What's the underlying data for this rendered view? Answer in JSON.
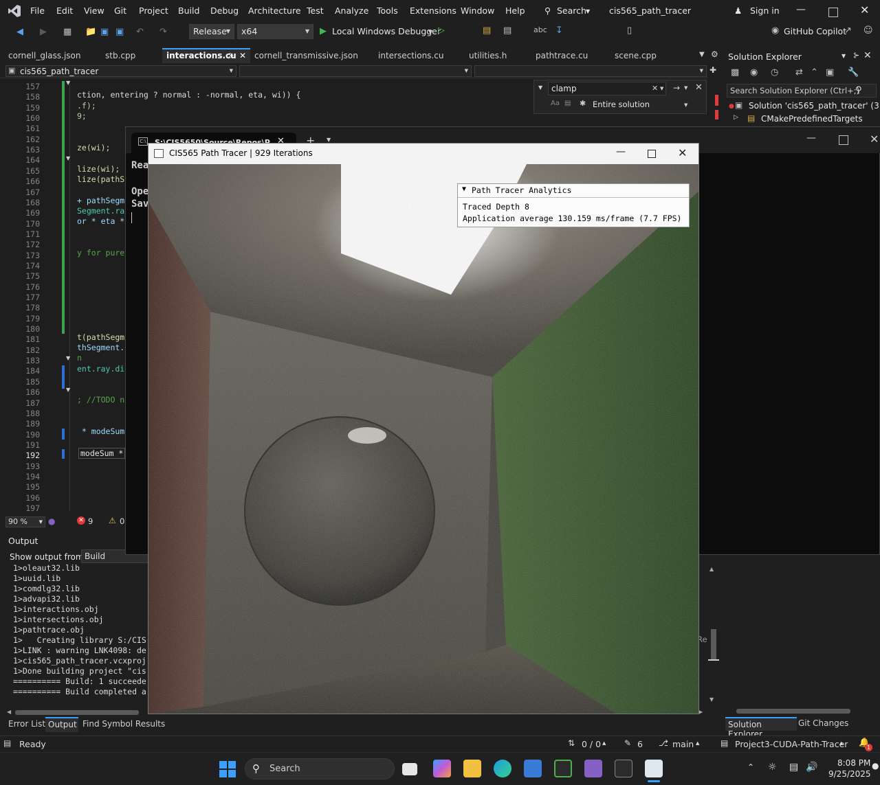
{
  "menubar": {
    "items": [
      "File",
      "Edit",
      "View",
      "Git",
      "Project",
      "Build",
      "Debug",
      "Architecture",
      "Test",
      "Analyze",
      "Tools",
      "Extensions",
      "Window",
      "Help"
    ],
    "search_label": "Search",
    "solution_title": "cis565_path_tracer",
    "sign_in": "Sign in"
  },
  "toolbar": {
    "config": "Release",
    "platform": "x64",
    "debugger": "Local Windows Debugger",
    "copilot": "GitHub Copilot"
  },
  "tabs": [
    "cornell_glass.json",
    "stb.cpp",
    "interactions.cu",
    "cornell_transmissive.json",
    "intersections.cu",
    "utilities.h",
    "pathtrace.cu",
    "scene.cpp"
  ],
  "navbar": {
    "project": "cis565_path_tracer"
  },
  "find": {
    "query": "clamp",
    "scope": "Entire solution"
  },
  "editor": {
    "line_numbers": [
      "157",
      "158",
      "159",
      "160",
      "161",
      "162",
      "163",
      "164",
      "165",
      "166",
      "167",
      "168",
      "169",
      "170",
      "171",
      "172",
      "173",
      "174",
      "175",
      "176",
      "177",
      "178",
      "179",
      "180",
      "181",
      "182",
      "183",
      "184",
      "185",
      "186",
      "187",
      "188",
      "189",
      "190",
      "191",
      "192",
      "193",
      "194",
      "195",
      "196",
      "197"
    ],
    "zoom": "90 %",
    "errors": "9",
    "warnings": "0",
    "code_fragments": {
      "l158": "ction, entering ? normal : -normal, eta, wi)) {",
      "l159": ".f);",
      "l160": "9;",
      "l163": "ze(wi);",
      "l165": "lize(wi);",
      "l166": "lize(pathSe",
      "l168": "+ pathSegme",
      "l169": "Segment.ray",
      "l170": "or * eta *",
      "l173": "y for pure",
      "l181": "t(pathSegme",
      "l182": "thSegment.r",
      "l183": "n",
      "l184": "ent.ray.di",
      "l187": "; //TODO n",
      "l190": " * modeSum",
      "l192": "modeSum *"
    }
  },
  "console": {
    "title": "S:\\CIS5650\\Source\\Repos\\Pro",
    "lines": [
      "Rea",
      "Ope",
      "Sav"
    ]
  },
  "path_tracer": {
    "title": "CIS565 Path Tracer | 929 Iterations",
    "panel_title": "Path Tracer Analytics",
    "depth_line": "Traced Depth 8",
    "fps_line": "Application average 130.159 ms/frame (7.7 FPS)"
  },
  "output": {
    "title": "Output",
    "show_from_label": "Show output from:",
    "source": "Build",
    "lines": [
      "1>oleaut32.lib",
      "1>uuid.lib",
      "1>comdlg32.lib",
      "1>advapi32.lib",
      "1>interactions.obj",
      "1>intersections.obj",
      "1>pathtrace.obj",
      "1>   Creating library S:/CIS",
      "1>LINK : warning LNK4098: de",
      "1>cis565_path_tracer.vcxproj",
      "1>Done building project \"cis",
      "========== Build: 1 succeede",
      "========== Build completed a"
    ],
    "right_fragment": "Re",
    "bottom_tabs": [
      "Error List",
      "Output",
      "Find Symbol Results"
    ]
  },
  "solution_explorer": {
    "title": "Solution Explorer",
    "search_placeholder": "Search Solution Explorer (Ctrl+;)",
    "solution_item": "Solution 'cis565_path_tracer' (3 of 3",
    "folder_item": "CMakePredefinedTargets",
    "bottom_tabs": [
      "Solution Explorer",
      "Git Changes"
    ]
  },
  "statusbar": {
    "ready": "Ready",
    "updown": "0 / 0",
    "edits": "6",
    "branch": "main",
    "repo": "Project3-CUDA-Path-Tracer",
    "notif_count": "1"
  },
  "taskbar": {
    "search": "Search",
    "time": "8:08 PM",
    "date": "9/25/2025"
  },
  "colors": {
    "accent": "#3aa0ff",
    "vs_purple": "#8661c5",
    "green_wall": "#2e4a1e",
    "red_wall": "#4a2a24",
    "error_red": "#e03a3a"
  }
}
